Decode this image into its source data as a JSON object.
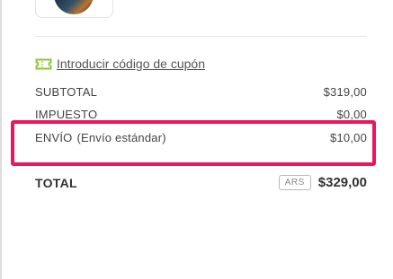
{
  "coupon": {
    "link_text": "Introducir código de cupón",
    "icon": "ticket-icon",
    "icon_color": "#8cc63f"
  },
  "summary": {
    "subtotal_label": "SUBTOTAL",
    "subtotal_value": "$319,00",
    "tax_label": "IMPUESTO",
    "tax_value": "$0,00",
    "shipping_label": "ENVÍO",
    "shipping_method": "(Envío estándar)",
    "shipping_value": "$10,00",
    "total_label": "TOTAL",
    "currency": "ARS",
    "total_value": "$329,00"
  },
  "colors": {
    "highlight": "#ed1460",
    "text": "#444444"
  }
}
